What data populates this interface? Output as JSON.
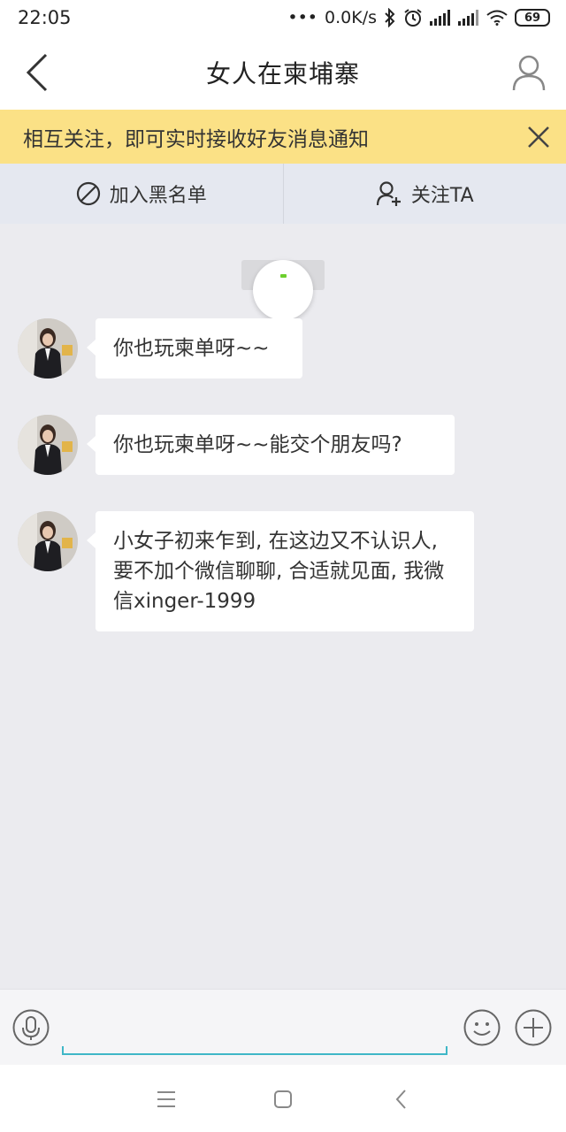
{
  "status_bar": {
    "time": "22:05",
    "network_speed": "0.0K/s",
    "battery_level": "69"
  },
  "header": {
    "title": "女人在柬埔寨"
  },
  "notice": {
    "text": "相互关注，即可实时接收好友消息通知"
  },
  "actions": {
    "blacklist_label": "加入黑名单",
    "follow_label": "关注TA"
  },
  "messages": [
    {
      "text": "你也玩柬单呀~~"
    },
    {
      "text": "你也玩柬单呀~~能交个朋友吗?"
    },
    {
      "text": "小女子初来乍到, 在这边又不认识人, 要不加个微信聊聊, 合适就见面, 我微信xinger-1999"
    }
  ],
  "input": {
    "value": "",
    "placeholder": ""
  },
  "colors": {
    "notice_background": "#fbe186",
    "action_bar_background": "#e5e8f0",
    "chat_background": "#ebebef",
    "input_underline": "#3fb7c7",
    "loader_accent": "#6ccf2d"
  }
}
